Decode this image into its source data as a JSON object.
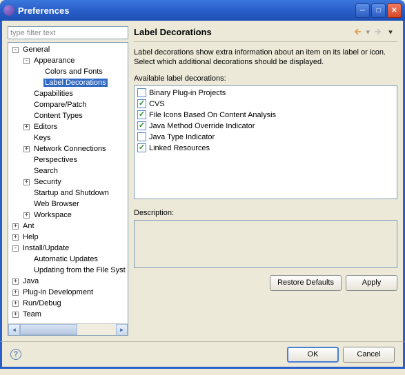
{
  "window": {
    "title": "Preferences"
  },
  "filter": {
    "placeholder": "type filter text"
  },
  "tree": [
    {
      "label": "General",
      "depth": 1,
      "exp": "-"
    },
    {
      "label": "Appearance",
      "depth": 2,
      "exp": "-"
    },
    {
      "label": "Colors and Fonts",
      "depth": 3,
      "exp": ""
    },
    {
      "label": "Label Decorations",
      "depth": 3,
      "exp": "",
      "selected": true
    },
    {
      "label": "Capabilities",
      "depth": 2,
      "exp": ""
    },
    {
      "label": "Compare/Patch",
      "depth": 2,
      "exp": ""
    },
    {
      "label": "Content Types",
      "depth": 2,
      "exp": ""
    },
    {
      "label": "Editors",
      "depth": 2,
      "exp": "+"
    },
    {
      "label": "Keys",
      "depth": 2,
      "exp": ""
    },
    {
      "label": "Network Connections",
      "depth": 2,
      "exp": "+"
    },
    {
      "label": "Perspectives",
      "depth": 2,
      "exp": ""
    },
    {
      "label": "Search",
      "depth": 2,
      "exp": ""
    },
    {
      "label": "Security",
      "depth": 2,
      "exp": "+"
    },
    {
      "label": "Startup and Shutdown",
      "depth": 2,
      "exp": ""
    },
    {
      "label": "Web Browser",
      "depth": 2,
      "exp": ""
    },
    {
      "label": "Workspace",
      "depth": 2,
      "exp": "+"
    },
    {
      "label": "Ant",
      "depth": 1,
      "exp": "+"
    },
    {
      "label": "Help",
      "depth": 1,
      "exp": "+"
    },
    {
      "label": "Install/Update",
      "depth": 1,
      "exp": "-"
    },
    {
      "label": "Automatic Updates",
      "depth": 2,
      "exp": ""
    },
    {
      "label": "Updating from the File Syst",
      "depth": 2,
      "exp": ""
    },
    {
      "label": "Java",
      "depth": 1,
      "exp": "+"
    },
    {
      "label": "Plug-in Development",
      "depth": 1,
      "exp": "+"
    },
    {
      "label": "Run/Debug",
      "depth": 1,
      "exp": "+"
    },
    {
      "label": "Team",
      "depth": 1,
      "exp": "+"
    }
  ],
  "page": {
    "title": "Label Decorations",
    "description": "Label decorations show extra information about an item on its label or icon. Select which additional decorations should be displayed.",
    "available_label": "Available label decorations:",
    "decorations": [
      {
        "label": "Binary Plug-in Projects",
        "checked": false
      },
      {
        "label": "CVS",
        "checked": true
      },
      {
        "label": "File Icons Based On Content Analysis",
        "checked": true
      },
      {
        "label": "Java Method Override Indicator",
        "checked": true
      },
      {
        "label": "Java Type Indicator",
        "checked": false
      },
      {
        "label": "Linked Resources",
        "checked": true
      }
    ],
    "description_label": "Description:"
  },
  "buttons": {
    "restore_defaults": "Restore Defaults",
    "apply": "Apply",
    "ok": "OK",
    "cancel": "Cancel"
  }
}
